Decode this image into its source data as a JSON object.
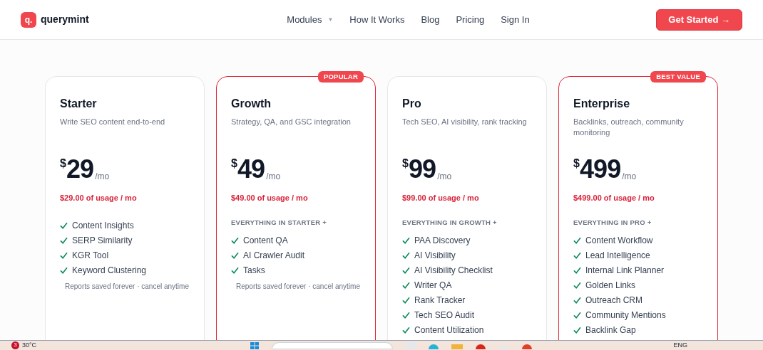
{
  "brand": {
    "name": "querymint",
    "logo_letter": "q."
  },
  "nav": [
    {
      "label": "Modules",
      "kind": "dropdown",
      "caret": "▼"
    },
    {
      "label": "How It Works",
      "kind": "link"
    },
    {
      "label": "Blog",
      "kind": "link"
    },
    {
      "label": "Pricing",
      "kind": "link"
    },
    {
      "label": "Sign In",
      "kind": "link"
    }
  ],
  "cta": "Get Started →",
  "plans": [
    {
      "name": "Starter",
      "featured": false,
      "description": "Write SEO content end-to-end",
      "currency": "$",
      "amount": "29",
      "period": "/mo",
      "usage": "$29.00 of usage / mo",
      "features": [
        "Content Insights",
        "SERP Similarity",
        "KGR Tool",
        "Keyword Clustering"
      ],
      "note": "Reports saved forever · cancel anytime"
    },
    {
      "name": "Growth",
      "featured": true,
      "badge": "POPULAR",
      "description": "Strategy, QA, and GSC integration",
      "currency": "$",
      "amount": "49",
      "period": "/mo",
      "usage": "$49.00 of usage / mo",
      "includes": "EVERYTHING IN STARTER +",
      "features": [
        "Content QA",
        "AI Crawler Audit",
        "Tasks"
      ],
      "note": "Reports saved forever · cancel anytime"
    },
    {
      "name": "Pro",
      "featured": false,
      "description": "Tech SEO, AI visibility, rank tracking",
      "currency": "$",
      "amount": "99",
      "period": "/mo",
      "usage": "$99.00 of usage / mo",
      "includes": "EVERYTHING IN GROWTH +",
      "features": [
        "PAA Discovery",
        "AI Visibility",
        "AI Visibility Checklist",
        "Writer QA",
        "Rank Tracker",
        "Tech SEO Audit",
        "Content Utilization"
      ]
    },
    {
      "name": "Enterprise",
      "featured": true,
      "badge": "BEST VALUE",
      "description": "Backlinks, outreach, community monitoring",
      "currency": "$",
      "amount": "499",
      "period": "/mo",
      "usage": "$499.00 of usage / mo",
      "includes": "EVERYTHING IN PRO +",
      "features": [
        "Content Workflow",
        "Lead Intelligence",
        "Internal Link Planner",
        "Golden Links",
        "Outreach CRM",
        "Community Mentions",
        "Backlink Gap"
      ]
    }
  ],
  "taskbar": {
    "weather_badge": "3",
    "temperature": "30°C",
    "language": "ENG"
  }
}
